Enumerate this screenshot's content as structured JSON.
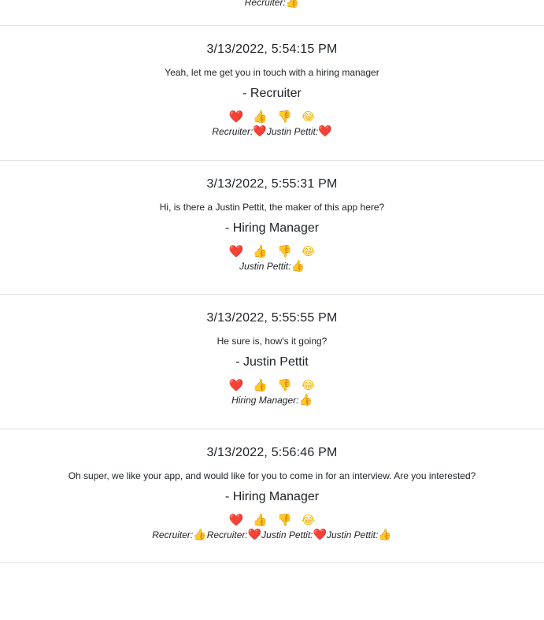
{
  "partial_top": {
    "reactions_given": [
      {
        "who": "Recruiter:",
        "icon": "👍"
      }
    ]
  },
  "reaction_buttons": {
    "heart": "❤️",
    "thumbs_up": "👍",
    "thumbs_down": "👎",
    "laugh": "😂"
  },
  "messages": [
    {
      "timestamp": "3/13/2022, 5:54:15 PM",
      "text": "Yeah, let me get you in touch with a hiring manager",
      "author": "- Recruiter",
      "reactions_given": [
        {
          "who": "Recruiter:",
          "icon": "❤️"
        },
        {
          "who": "Justin Pettit:",
          "icon": "❤️"
        }
      ]
    },
    {
      "timestamp": "3/13/2022, 5:55:31 PM",
      "text": "Hi, is there a Justin Pettit, the maker of this app here?",
      "author": "- Hiring Manager",
      "reactions_given": [
        {
          "who": "Justin Pettit:",
          "icon": "👍"
        }
      ]
    },
    {
      "timestamp": "3/13/2022, 5:55:55 PM",
      "text": "He sure is, how's it going?",
      "author": "- Justin Pettit",
      "reactions_given": [
        {
          "who": "Hiring Manager:",
          "icon": "👍"
        }
      ]
    },
    {
      "timestamp": "3/13/2022, 5:56:46 PM",
      "text": "Oh super, we like your app, and would like for you to come in for an interview. Are you interested?",
      "author": "- Hiring Manager",
      "reactions_given": [
        {
          "who": "Recruiter:",
          "icon": "👍"
        },
        {
          "who": "Recruiter:",
          "icon": "❤️"
        },
        {
          "who": "Justin Pettit:",
          "icon": "❤️"
        },
        {
          "who": "Justin Pettit:",
          "icon": "👍"
        }
      ]
    }
  ]
}
